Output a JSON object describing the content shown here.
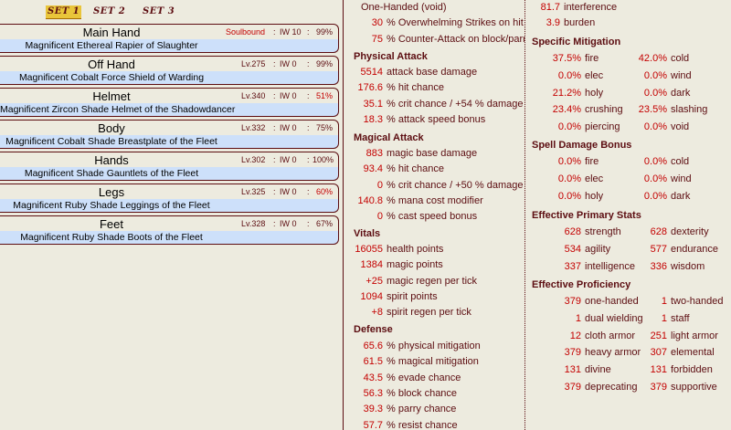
{
  "sets": [
    "SET 1",
    "SET 2",
    "SET 3"
  ],
  "equipment": [
    {
      "slot": "Main Hand",
      "lvl": "Soulbound",
      "iw": "IW 10",
      "pct": "99%",
      "pct_warn": false,
      "soulbound": true,
      "name": "Magnificent Ethereal Rapier of Slaughter"
    },
    {
      "slot": "Off Hand",
      "lvl": "Lv.275",
      "iw": "IW 0",
      "pct": "99%",
      "pct_warn": false,
      "soulbound": false,
      "name": "Magnificent Cobalt Force Shield of Warding"
    },
    {
      "slot": "Helmet",
      "lvl": "Lv.340",
      "iw": "IW 0",
      "pct": "51%",
      "pct_warn": true,
      "soulbound": false,
      "name": "Magnificent Zircon Shade Helmet of the Shadowdancer"
    },
    {
      "slot": "Body",
      "lvl": "Lv.332",
      "iw": "IW 0",
      "pct": "75%",
      "pct_warn": false,
      "soulbound": false,
      "name": "Magnificent Cobalt Shade Breastplate of the Fleet"
    },
    {
      "slot": "Hands",
      "lvl": "Lv.302",
      "iw": "IW 0",
      "pct": "100%",
      "pct_warn": false,
      "soulbound": false,
      "name": "Magnificent Shade Gauntlets of the Fleet"
    },
    {
      "slot": "Legs",
      "lvl": "Lv.325",
      "iw": "IW 0",
      "pct": "60%",
      "pct_warn": true,
      "soulbound": false,
      "name": "Magnificent Ruby Shade Leggings of the Fleet"
    },
    {
      "slot": "Feet",
      "lvl": "Lv.328",
      "iw": "IW 0",
      "pct": "67%",
      "pct_warn": false,
      "soulbound": false,
      "name": "Magnificent Ruby Shade Boots of the Fleet"
    }
  ],
  "sep": ":",
  "middle": {
    "top_lines": [
      {
        "value": "",
        "text": "One-Handed (void)"
      },
      {
        "value": "30",
        "text": "% Overwhelming Strikes on hit"
      },
      {
        "value": "75",
        "text": "% Counter-Attack on block/parry"
      }
    ],
    "physical": {
      "title": "Physical Attack",
      "rows": [
        {
          "value": "5514",
          "text": "attack base damage"
        },
        {
          "value": "176.6",
          "text": "% hit chance"
        },
        {
          "value": "35.1",
          "text": "% crit chance / +54 % damage"
        },
        {
          "value": "18.3",
          "text": "% attack speed bonus"
        }
      ]
    },
    "magical": {
      "title": "Magical Attack",
      "rows": [
        {
          "value": "883",
          "text": "magic base damage"
        },
        {
          "value": "93.4",
          "text": "% hit chance"
        },
        {
          "value": "0",
          "text": "% crit chance / +50 % damage"
        },
        {
          "value": "140.8",
          "text": "% mana cost modifier"
        },
        {
          "value": "0",
          "text": "% cast speed bonus"
        }
      ]
    },
    "vitals": {
      "title": "Vitals",
      "rows": [
        {
          "value": "16055",
          "text": "health points"
        },
        {
          "value": "1384",
          "text": "magic points"
        },
        {
          "value": "+25",
          "text": "magic regen per tick"
        },
        {
          "value": "1094",
          "text": "spirit points"
        },
        {
          "value": "+8",
          "text": "spirit regen per tick"
        }
      ]
    },
    "defense": {
      "title": "Defense",
      "rows": [
        {
          "value": "65.6",
          "text": "% physical mitigation"
        },
        {
          "value": "61.5",
          "text": "% magical mitigation"
        },
        {
          "value": "43.5",
          "text": "% evade chance"
        },
        {
          "value": "56.3",
          "text": "% block chance"
        },
        {
          "value": "39.3",
          "text": "% parry chance"
        },
        {
          "value": "57.7",
          "text": "% resist chance"
        }
      ]
    }
  },
  "right": {
    "top_lines": [
      {
        "value": "81.7",
        "text": "interference"
      },
      {
        "value": "3.9",
        "text": "burden"
      }
    ],
    "specific_mitigation": {
      "title": "Specific Mitigation",
      "rows": [
        [
          {
            "value": "37.5%",
            "text": "fire"
          },
          {
            "value": "42.0%",
            "text": "cold"
          }
        ],
        [
          {
            "value": "0.0%",
            "text": "elec"
          },
          {
            "value": "0.0%",
            "text": "wind"
          }
        ],
        [
          {
            "value": "21.2%",
            "text": "holy"
          },
          {
            "value": "0.0%",
            "text": "dark"
          }
        ],
        [
          {
            "value": "23.4%",
            "text": "crushing"
          },
          {
            "value": "23.5%",
            "text": "slashing"
          }
        ],
        [
          {
            "value": "0.0%",
            "text": "piercing"
          },
          {
            "value": "0.0%",
            "text": "void"
          }
        ]
      ]
    },
    "spell_damage": {
      "title": "Spell Damage Bonus",
      "rows": [
        [
          {
            "value": "0.0%",
            "text": "fire"
          },
          {
            "value": "0.0%",
            "text": "cold"
          }
        ],
        [
          {
            "value": "0.0%",
            "text": "elec"
          },
          {
            "value": "0.0%",
            "text": "wind"
          }
        ],
        [
          {
            "value": "0.0%",
            "text": "holy"
          },
          {
            "value": "0.0%",
            "text": "dark"
          }
        ]
      ]
    },
    "primary_stats": {
      "title": "Effective Primary Stats",
      "rows": [
        [
          {
            "value": "628",
            "text": "strength"
          },
          {
            "value": "628",
            "text": "dexterity"
          }
        ],
        [
          {
            "value": "534",
            "text": "agility"
          },
          {
            "value": "577",
            "text": "endurance"
          }
        ],
        [
          {
            "value": "337",
            "text": "intelligence"
          },
          {
            "value": "336",
            "text": "wisdom"
          }
        ]
      ]
    },
    "proficiency": {
      "title": "Effective Proficiency",
      "rows": [
        [
          {
            "value": "379",
            "text": "one-handed"
          },
          {
            "value": "1",
            "text": "two-handed"
          }
        ],
        [
          {
            "value": "1",
            "text": "dual wielding"
          },
          {
            "value": "1",
            "text": "staff"
          }
        ],
        [
          {
            "value": "12",
            "text": "cloth armor"
          },
          {
            "value": "251",
            "text": "light armor"
          }
        ],
        [
          {
            "value": "379",
            "text": "heavy armor"
          },
          {
            "value": "307",
            "text": "elemental"
          }
        ],
        [
          {
            "value": "131",
            "text": "divine"
          },
          {
            "value": "131",
            "text": "forbidden"
          }
        ],
        [
          {
            "value": "379",
            "text": "deprecating"
          },
          {
            "value": "379",
            "text": "supportive"
          }
        ]
      ]
    }
  }
}
